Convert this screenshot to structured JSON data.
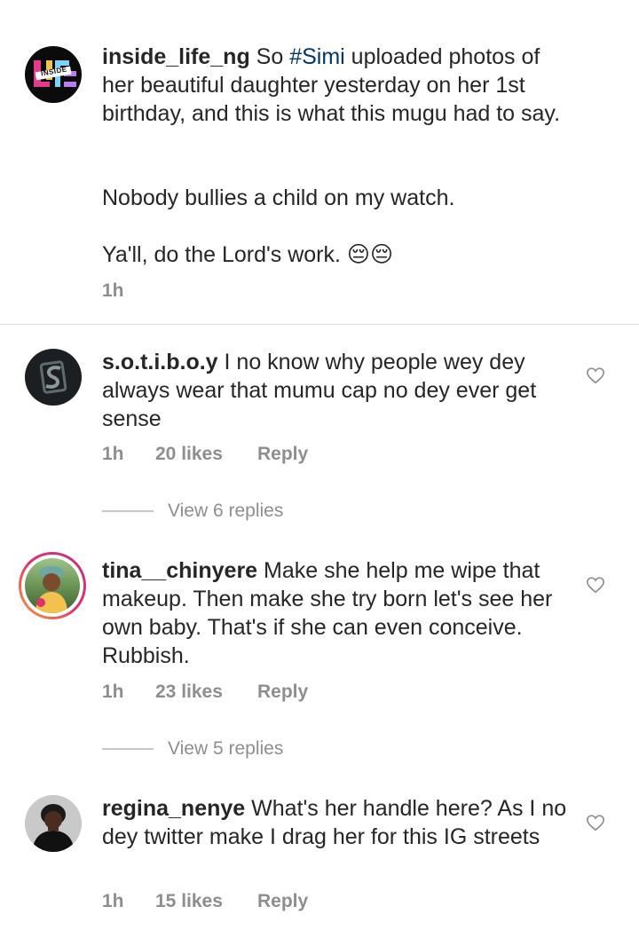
{
  "caption": {
    "username": "inside_life_ng",
    "text_before_tag": "So ",
    "hashtag": "#Simi",
    "text_after_tag": " uploaded photos of her beautiful daughter yesterday on her 1st birthday, and this is what this mugu had to say.",
    "paragraph2": "Nobody bullies a child on my watch.",
    "paragraph3": "Ya'll, do the Lord's work. 😔😔",
    "time": "1h",
    "avatar_text": "INSIDE"
  },
  "comments": [
    {
      "username": "s.o.t.i.b.o.y",
      "text": "I no know why people wey dey always wear that mumu cap no dey ever get sense",
      "time": "1h",
      "likes": "20 likes",
      "reply": "Reply",
      "view_replies": "View 6 replies",
      "avatar_glyph": "S"
    },
    {
      "username": "tina__chinyere",
      "text": "Make she help me wipe that makeup.  Then make she try born let's see her own baby. That's if she can even conceive.  Rubbish.",
      "time": "1h",
      "likes": "23 likes",
      "reply": "Reply",
      "view_replies": "View 5 replies"
    },
    {
      "username": "regina_nenye",
      "text": "What's her handle here? As I no dey twitter make I drag her for this IG streets",
      "time": "1h",
      "likes": "15 likes",
      "reply": "Reply"
    }
  ],
  "colors": {
    "text": "#262626",
    "meta": "#8e8e8e",
    "hashtag": "#00376b",
    "story_ring": "#e1306c"
  }
}
